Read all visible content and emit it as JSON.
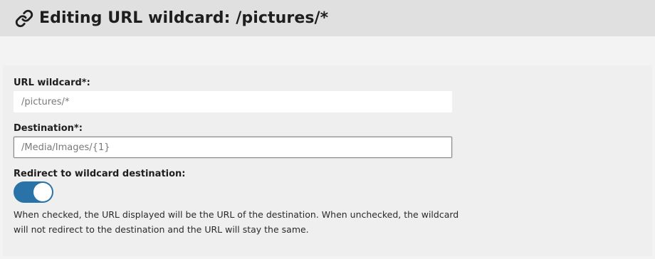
{
  "header": {
    "icon": "link-icon",
    "title": "Editing URL wildcard: /pictures/*"
  },
  "form": {
    "url_wildcard": {
      "label": "URL wildcard*:",
      "value": "/pictures/*"
    },
    "destination": {
      "label": "Destination*:",
      "value": "/Media/Images/{1}"
    },
    "redirect": {
      "label": "Redirect to wildcard destination:",
      "checked": true,
      "help": "When checked, the URL displayed will be the URL of the destination. When unchecked, the wildcard will not redirect to the destination and the URL will stay the same."
    }
  },
  "colors": {
    "toggle_on": "#2a73a8",
    "header_bg": "#e0e0e0",
    "page_bg": "#f3f3f3"
  }
}
